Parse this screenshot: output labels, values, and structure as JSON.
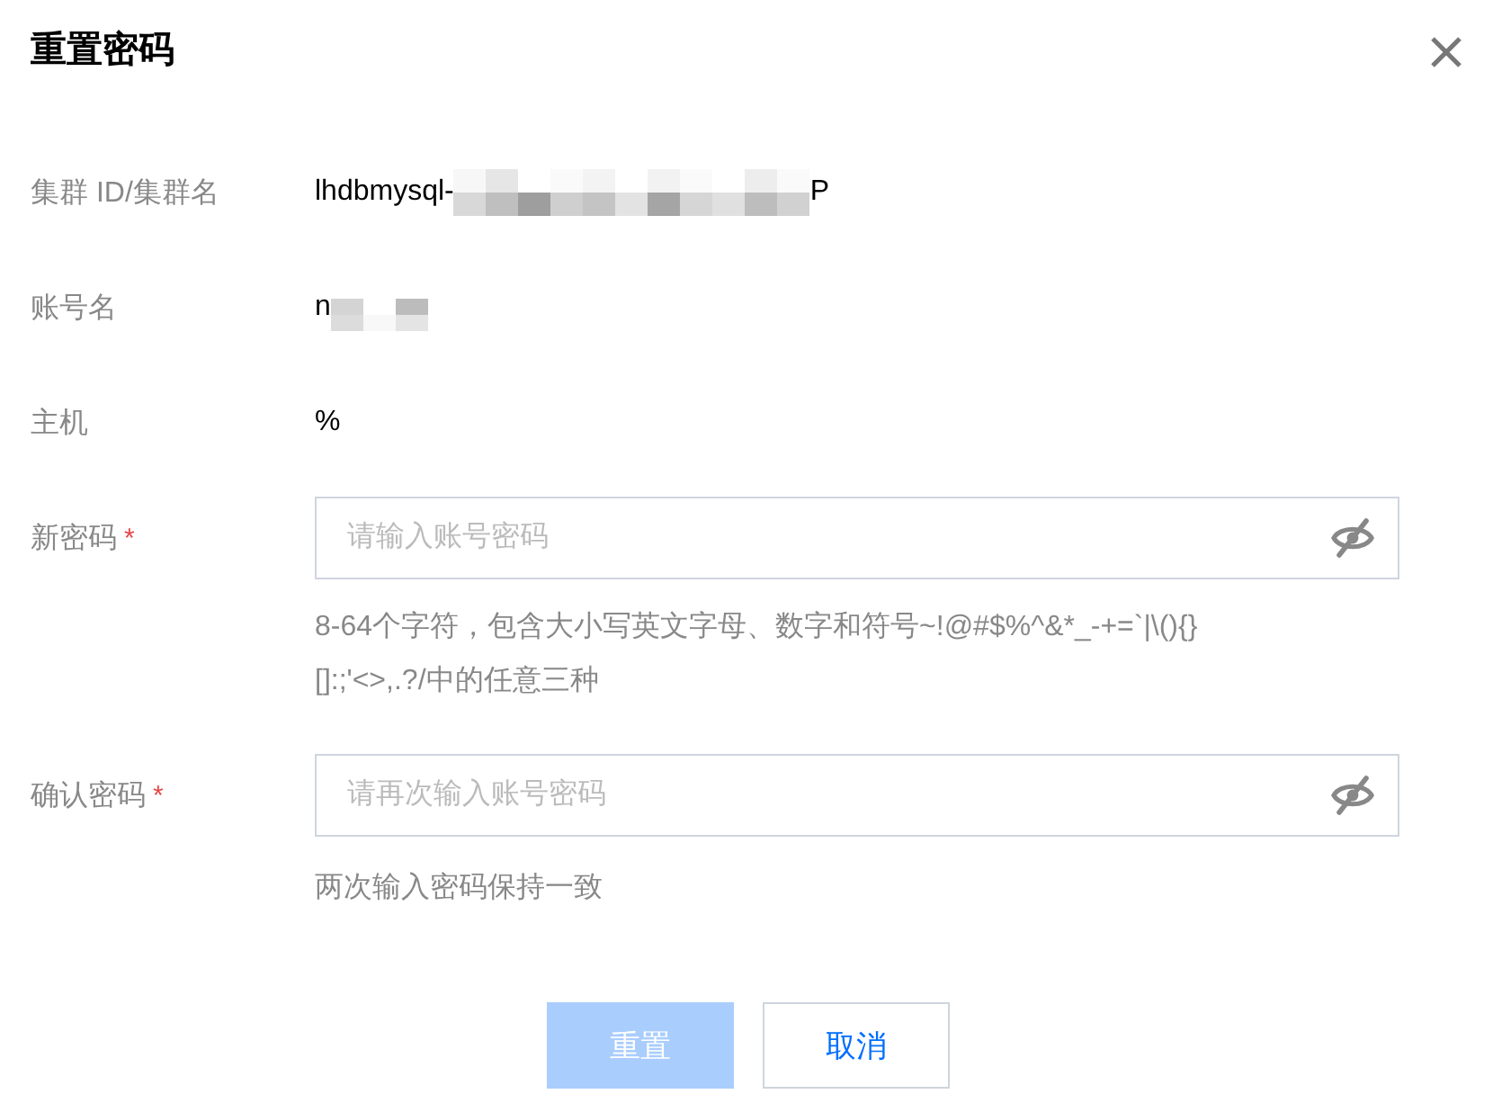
{
  "dialog": {
    "title": "重置密码"
  },
  "info_rows": [
    {
      "label": "集群 ID/集群名",
      "value": "lhdbmysql-",
      "redacted": true,
      "suffix": "P"
    },
    {
      "label": "账号名",
      "value": "n",
      "redacted": true
    },
    {
      "label": "主机",
      "value": "%",
      "redacted": false
    }
  ],
  "password_fields": [
    {
      "label": "新密码",
      "required_mark": "*",
      "placeholder": "请输入账号密码",
      "hint": "8-64个字符，包含大小写英文字母、数字和符号~!@#$%^&*_-+=`|\\(){}[]:;'<>,.?/中的任意三种"
    },
    {
      "label": "确认密码",
      "required_mark": "*",
      "placeholder": "请再次输入账号密码",
      "hint": "两次输入密码保持一致"
    }
  ],
  "buttons": [
    {
      "label": "重置",
      "kind": "primary",
      "disabled": true
    },
    {
      "label": "取消",
      "kind": "secondary",
      "disabled": false
    }
  ]
}
